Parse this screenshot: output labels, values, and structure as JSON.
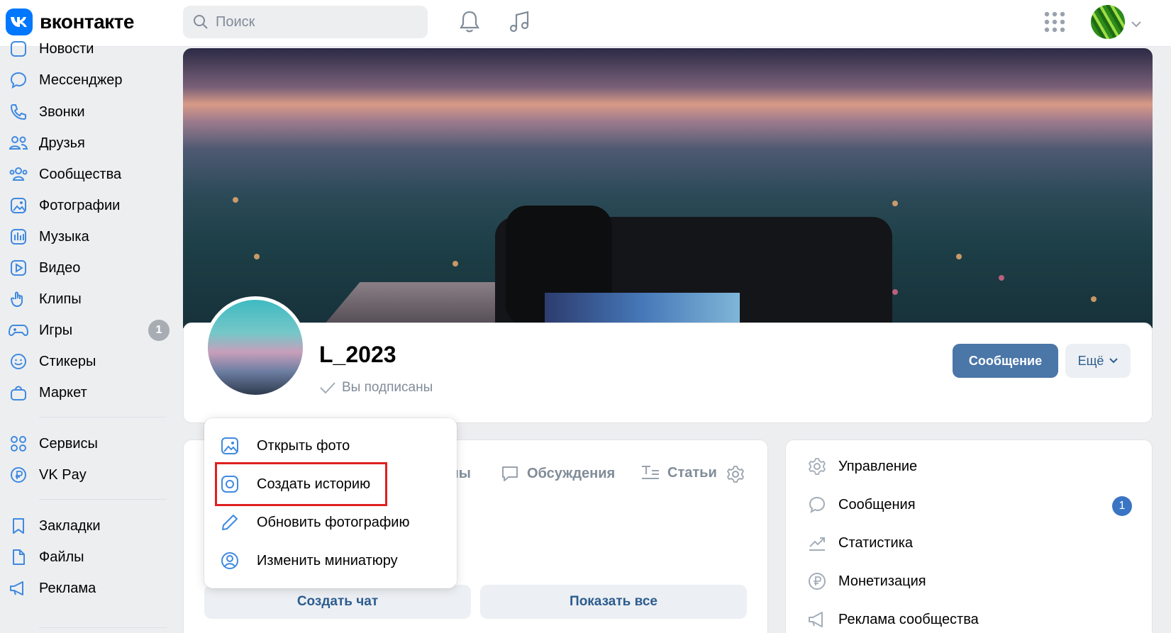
{
  "app": {
    "logo_text": "вконтакте"
  },
  "search": {
    "placeholder": "Поиск"
  },
  "sidebar": {
    "items": [
      {
        "label": "Новости"
      },
      {
        "label": "Мессенджер"
      },
      {
        "label": "Звонки"
      },
      {
        "label": "Друзья"
      },
      {
        "label": "Сообщества"
      },
      {
        "label": "Фотографии"
      },
      {
        "label": "Музыка"
      },
      {
        "label": "Видео"
      },
      {
        "label": "Клипы"
      },
      {
        "label": "Игры",
        "badge": "1"
      },
      {
        "label": "Стикеры"
      },
      {
        "label": "Маркет"
      },
      {
        "label": "Сервисы"
      },
      {
        "label": "VK Pay"
      },
      {
        "label": "Закладки"
      },
      {
        "label": "Файлы"
      },
      {
        "label": "Реклама"
      }
    ]
  },
  "profile": {
    "name": "L_2023",
    "status": "Вы подписаны",
    "message_button": "Сообщение",
    "more_button": "Ещё"
  },
  "dropdown": {
    "items": [
      {
        "label": "Открыть фото"
      },
      {
        "label": "Создать историю"
      },
      {
        "label": "Обновить фотографию"
      },
      {
        "label": "Изменить миниатюру"
      }
    ]
  },
  "tabs": {
    "partial": "лы",
    "discussions": "Обсуждения",
    "articles": "Статьи"
  },
  "actions": {
    "create_chat": "Создать чат",
    "show_all": "Показать все"
  },
  "right_menu": {
    "items": [
      {
        "label": "Управление"
      },
      {
        "label": "Сообщения",
        "badge": "1"
      },
      {
        "label": "Статистика"
      },
      {
        "label": "Монетизация"
      },
      {
        "label": "Реклама сообщества"
      }
    ]
  },
  "colors": {
    "accent": "#4a76a8",
    "brand": "#0077ff",
    "highlight": "#e02020",
    "badge": "#3a75c4"
  }
}
